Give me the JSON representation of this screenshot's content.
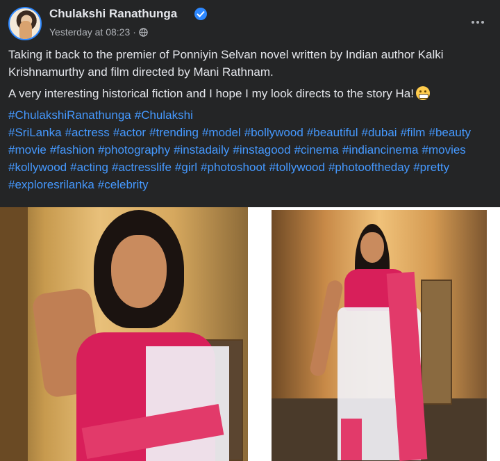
{
  "post": {
    "author": "Chulakshi Ranathunga",
    "timestamp": "Yesterday at 08:23",
    "meta_separator": "·",
    "paragraph1": "Taking it back to the premier of Ponniyin Selvan novel written by Indian author Kalki Krishnamurthy and film directed by Mani Rathnam.",
    "paragraph2": "A very interesting historical fiction and I hope I my look directs to the story Ha!",
    "hashtags": [
      "#ChulakshiRanathunga",
      "#Chulakshi",
      "#SriLanka",
      "#actress",
      "#actor",
      "#trending",
      "#model",
      "#bollywood",
      "#beautiful",
      "#dubai",
      "#film",
      "#beauty",
      "#movie",
      "#fashion",
      "#photography",
      "#instadaily",
      "#instagood",
      "#cinema",
      "#indiancinema",
      "#movies",
      "#kollywood",
      "#acting",
      "#actresslife",
      "#girl",
      "#photoshoot",
      "#tollywood",
      "#photooftheday",
      "#pretty",
      "#exploresrilanka",
      "#celebrity"
    ]
  },
  "icons": {
    "verified": "verified-badge-icon",
    "privacy": "globe-icon",
    "more": "more-options-icon",
    "emoji": "grimacing-face-emoji"
  },
  "colors": {
    "background": "#242526",
    "text": "#e4e6eb",
    "secondary_text": "#b0b3b8",
    "hashtag": "#4599ff",
    "verified": "#2d88ff"
  }
}
